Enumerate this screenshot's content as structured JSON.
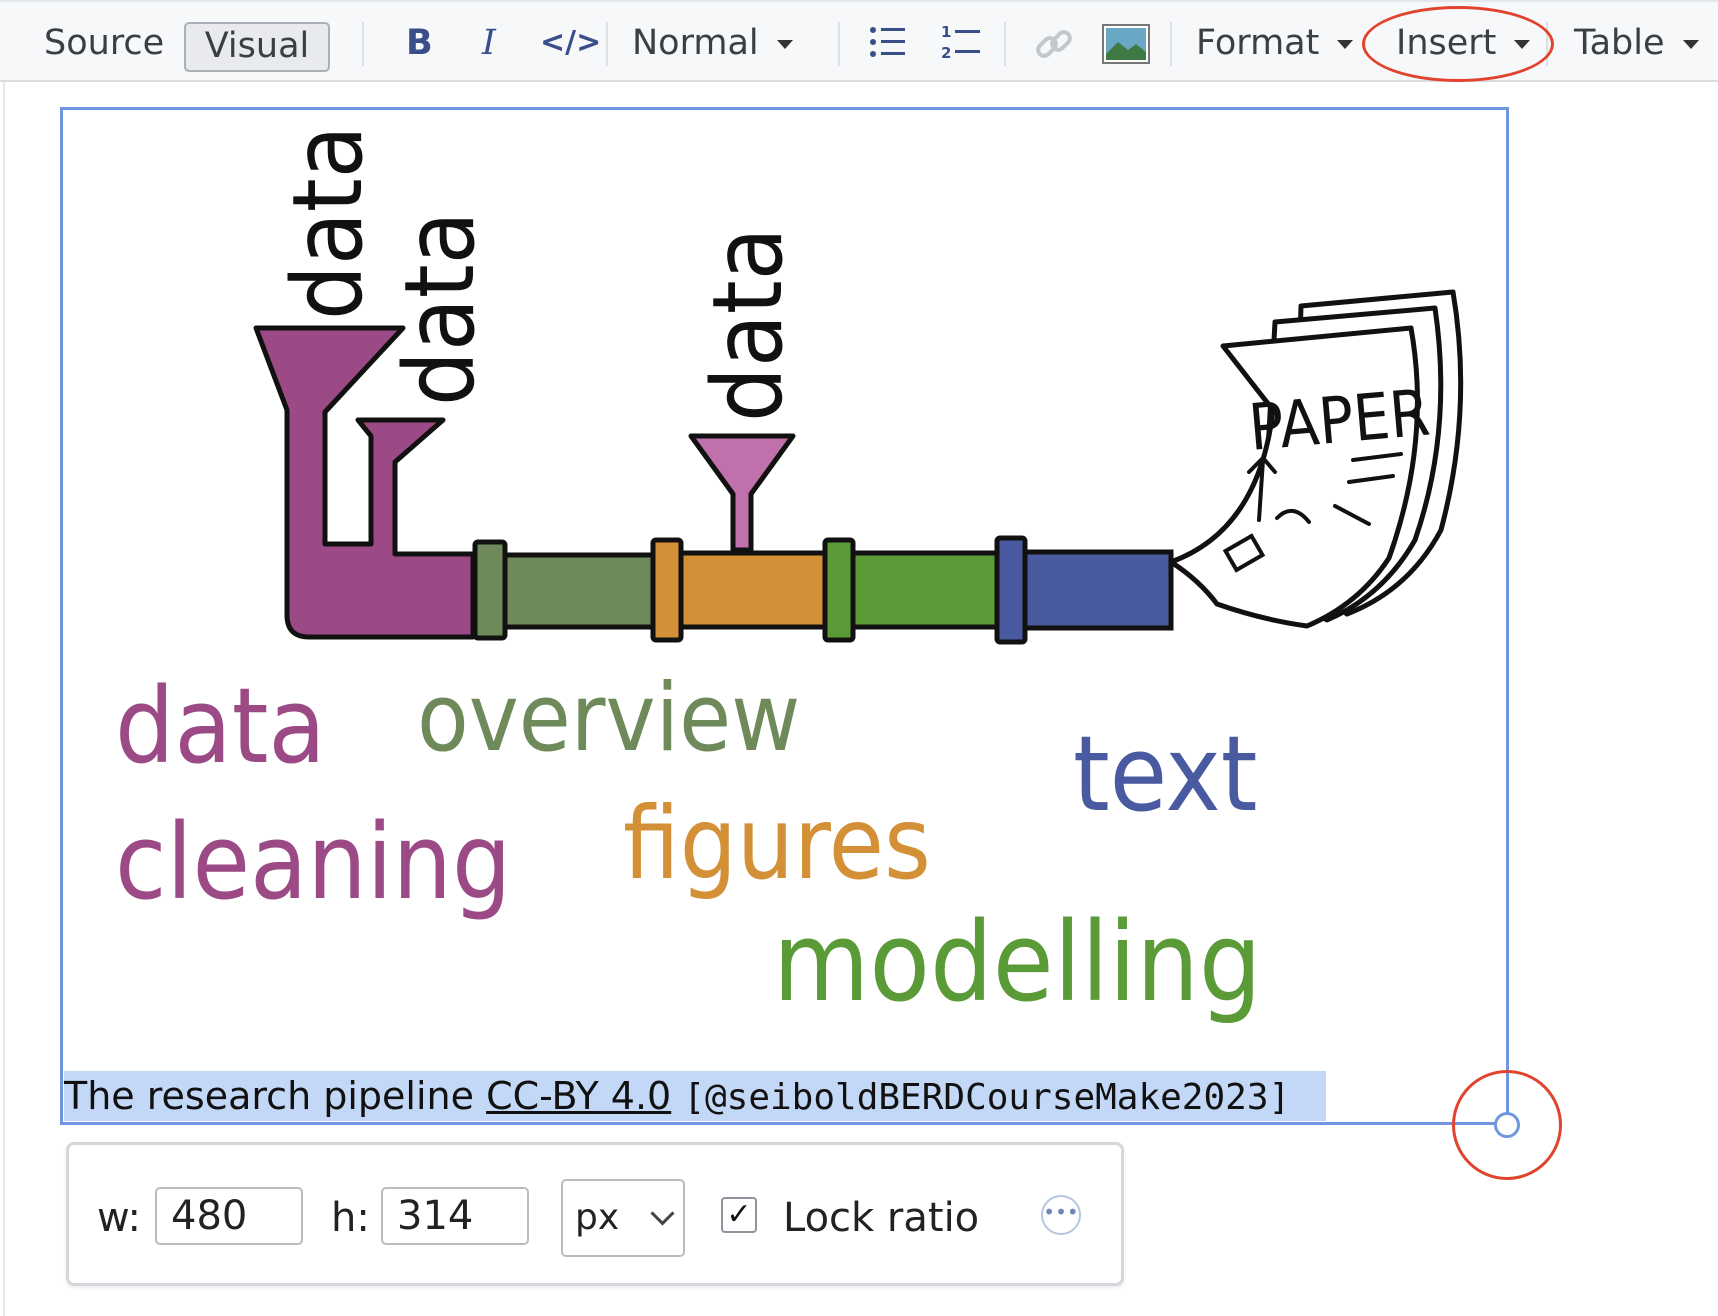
{
  "toolbar": {
    "source_label": "Source",
    "visual_label": "Visual",
    "bold_label": "B",
    "italic_label": "I",
    "code_label": "</>",
    "paragraph_style": "Normal",
    "format_label": "Format",
    "insert_label": "Insert",
    "table_label": "Table",
    "icons": [
      "bold-icon",
      "italic-icon",
      "code-icon",
      "bullet-list-icon",
      "numbered-list-icon",
      "link-icon",
      "image-icon"
    ]
  },
  "figure": {
    "illustration": {
      "funnel_words": [
        "data",
        "data",
        "data"
      ],
      "paper_word": "PAPER",
      "stage_words": {
        "cleaning_1": "data",
        "cleaning_2": "cleaning",
        "overview": "overview",
        "figures": "figures",
        "modelling": "modelling",
        "text": "text"
      }
    },
    "caption": {
      "text": "The research pipeline ",
      "link": "CC-BY 4.0",
      "citation": "[@seiboldBERDCourseMake2023]"
    }
  },
  "size_panel": {
    "width_label": "w:",
    "width_value": "480",
    "height_label": "h:",
    "height_value": "314",
    "unit": "px",
    "lock_label": "Lock ratio",
    "lock_checked": true,
    "more_icon": "ellipsis-icon"
  },
  "colors": {
    "selection_border": "#6f97e0",
    "annotation": "#e0442f",
    "purple": "#9b4a86",
    "sage": "#6e8a5a",
    "orange": "#d49036",
    "green": "#5a9a37",
    "blue": "#4a5aa0"
  }
}
